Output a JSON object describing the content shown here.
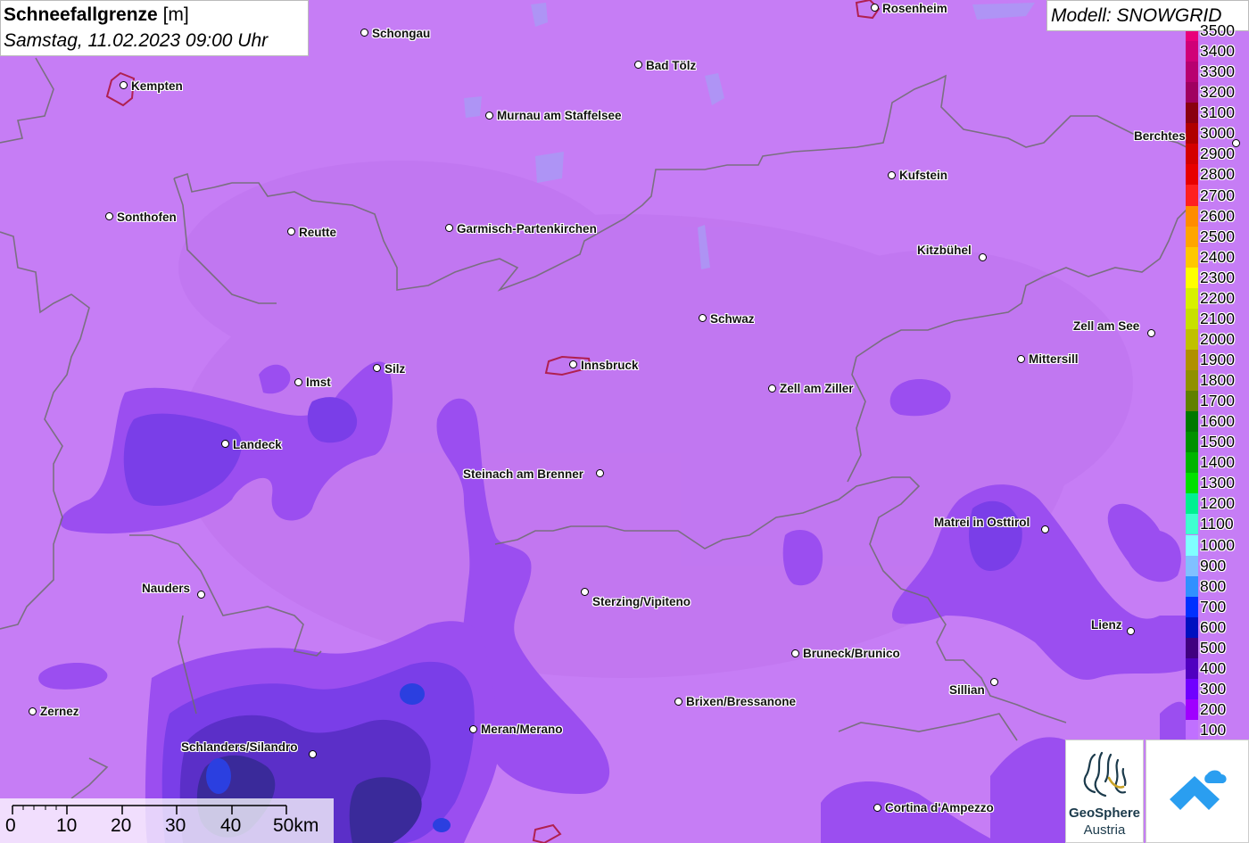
{
  "header": {
    "title_bold": "Schneefallgrenze",
    "title_unit": "[m]",
    "date": "Samstag, 11.02.2023 09:00 Uhr"
  },
  "model": {
    "label": "Modell: SNOWGRID"
  },
  "legend": {
    "items": [
      {
        "value": "3500",
        "color": "#e8007a"
      },
      {
        "value": "3400",
        "color": "#d00078"
      },
      {
        "value": "3300",
        "color": "#b80070"
      },
      {
        "value": "3200",
        "color": "#a00060"
      },
      {
        "value": "3100",
        "color": "#8a0010"
      },
      {
        "value": "3000",
        "color": "#b00000"
      },
      {
        "value": "2900",
        "color": "#d40000"
      },
      {
        "value": "2800",
        "color": "#e80000"
      },
      {
        "value": "2700",
        "color": "#ff2020"
      },
      {
        "value": "2600",
        "color": "#ff8c00"
      },
      {
        "value": "2500",
        "color": "#ffa500"
      },
      {
        "value": "2400",
        "color": "#ffc800"
      },
      {
        "value": "2300",
        "color": "#ffff00"
      },
      {
        "value": "2200",
        "color": "#d8f000"
      },
      {
        "value": "2100",
        "color": "#c8e000"
      },
      {
        "value": "2000",
        "color": "#c0c000"
      },
      {
        "value": "1900",
        "color": "#b09000"
      },
      {
        "value": "1800",
        "color": "#909000"
      },
      {
        "value": "1700",
        "color": "#608000"
      },
      {
        "value": "1600",
        "color": "#007800"
      },
      {
        "value": "1500",
        "color": "#009000"
      },
      {
        "value": "1400",
        "color": "#00b400"
      },
      {
        "value": "1300",
        "color": "#00e000"
      },
      {
        "value": "1200",
        "color": "#00f090"
      },
      {
        "value": "1100",
        "color": "#40ffd0"
      },
      {
        "value": "1000",
        "color": "#80ffff"
      },
      {
        "value": "900",
        "color": "#80c0ff"
      },
      {
        "value": "800",
        "color": "#3090ff"
      },
      {
        "value": "700",
        "color": "#0030ff"
      },
      {
        "value": "600",
        "color": "#0010c0"
      },
      {
        "value": "500",
        "color": "#400080"
      },
      {
        "value": "400",
        "color": "#5000c0"
      },
      {
        "value": "300",
        "color": "#7000ff"
      },
      {
        "value": "200",
        "color": "#a000ff"
      },
      {
        "value": "100",
        "color": "#c070ff"
      }
    ]
  },
  "cities": [
    {
      "name": "Rosenheim"
    },
    {
      "name": "Schongau"
    },
    {
      "name": "Kempten"
    },
    {
      "name": "Bad Tölz"
    },
    {
      "name": "Murnau am Staffelsee"
    },
    {
      "name": "Berchtes"
    },
    {
      "name": "Kufstein"
    },
    {
      "name": "Sonthofen"
    },
    {
      "name": "Reutte"
    },
    {
      "name": "Garmisch-Partenkirchen"
    },
    {
      "name": "Kitzbühel"
    },
    {
      "name": "Schwaz"
    },
    {
      "name": "Zell am See"
    },
    {
      "name": "Mittersill"
    },
    {
      "name": "Silz"
    },
    {
      "name": "Imst"
    },
    {
      "name": "Innsbruck"
    },
    {
      "name": "Zell am Ziller"
    },
    {
      "name": "Landeck"
    },
    {
      "name": "Steinach am Brenner"
    },
    {
      "name": "Matrei in Osttirol"
    },
    {
      "name": "Nauders"
    },
    {
      "name": "Sterzing/Vipiteno"
    },
    {
      "name": "Lienz"
    },
    {
      "name": "Bruneck/Brunico"
    },
    {
      "name": "Sillian"
    },
    {
      "name": "Brixen/Bressanone"
    },
    {
      "name": "Zernez"
    },
    {
      "name": "Meran/Merano"
    },
    {
      "name": "Schlanders/Silandro"
    },
    {
      "name": "Cortina d'Ampezzo"
    }
  ],
  "scale": {
    "labels": [
      "0",
      "10",
      "20",
      "30",
      "40",
      "50km"
    ]
  },
  "logos": {
    "geosphere_line1": "GeoSphere",
    "geosphere_line2": "Austria"
  },
  "colors": {
    "background": "#c67df5",
    "low_band": "#9a4cf0",
    "lower_band": "#7a3fe8",
    "deep_band": "#5a2fd0",
    "core": "#2b3fe0",
    "border": "#6d6d6d"
  }
}
